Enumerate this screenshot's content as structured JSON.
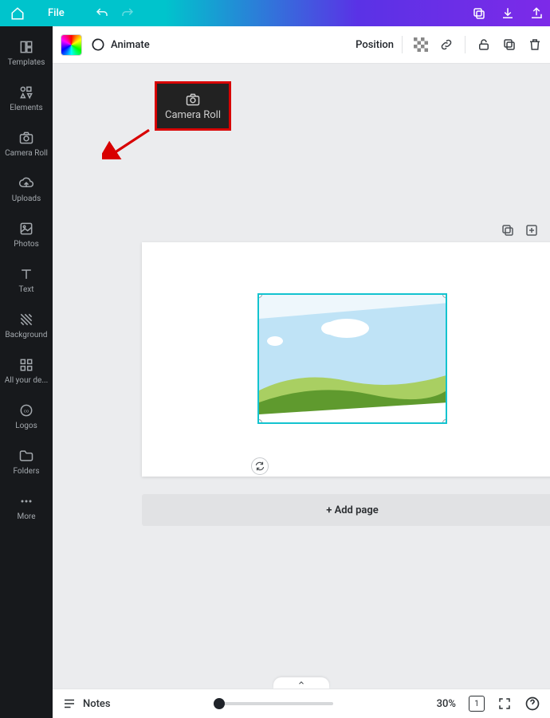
{
  "topbar": {
    "file_label": "File"
  },
  "sidebar": {
    "items": [
      {
        "id": "templates",
        "label": "Templates"
      },
      {
        "id": "elements",
        "label": "Elements"
      },
      {
        "id": "camera-roll",
        "label": "Camera Roll"
      },
      {
        "id": "uploads",
        "label": "Uploads"
      },
      {
        "id": "photos",
        "label": "Photos"
      },
      {
        "id": "text",
        "label": "Text"
      },
      {
        "id": "background",
        "label": "Background"
      },
      {
        "id": "all-designs",
        "label": "All your de..."
      },
      {
        "id": "logos",
        "label": "Logos"
      },
      {
        "id": "folders",
        "label": "Folders"
      },
      {
        "id": "more",
        "label": "More"
      }
    ]
  },
  "toolbar": {
    "animate_label": "Animate",
    "position_label": "Position"
  },
  "callout": {
    "label": "Camera Roll"
  },
  "addpage": {
    "label": "+ Add page"
  },
  "bottombar": {
    "notes_label": "Notes",
    "zoom_label": "30%",
    "page_indicator": "1"
  }
}
